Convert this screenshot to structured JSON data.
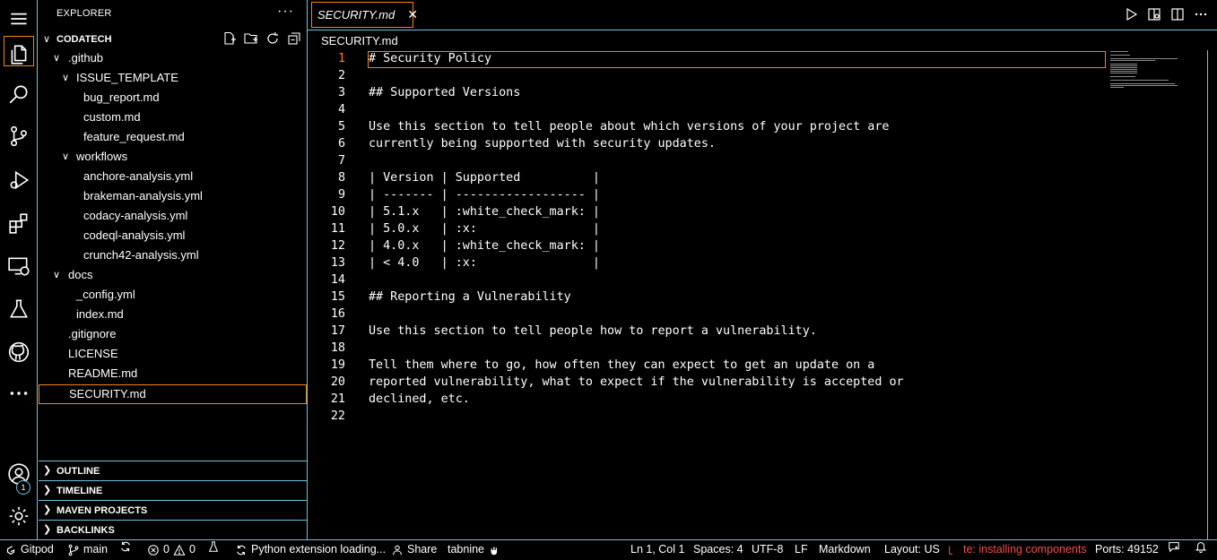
{
  "colors": {
    "accent_border": "#f38518",
    "contrast_border": "#6fc3df",
    "error": "#f14c4c",
    "background": "#000000"
  },
  "activity_bar": {
    "items": [
      "menu-icon",
      "files-icon",
      "search-icon",
      "source-control-icon",
      "run-debug-icon",
      "extensions-icon",
      "remote-explorer-icon",
      "testing-icon",
      "github-icon",
      "more-icon"
    ],
    "accounts_badge": "1"
  },
  "sidebar": {
    "title": "EXPLORER",
    "more": "···",
    "workspace": "CODATECH",
    "tree": [
      {
        "label": ".github",
        "twisty": "∨"
      },
      {
        "label": "ISSUE_TEMPLATE",
        "twisty": "∨"
      },
      {
        "label": "bug_report.md"
      },
      {
        "label": "custom.md"
      },
      {
        "label": "feature_request.md"
      },
      {
        "label": "workflows",
        "twisty": "∨"
      },
      {
        "label": "anchore-analysis.yml"
      },
      {
        "label": "brakeman-analysis.yml"
      },
      {
        "label": "codacy-analysis.yml"
      },
      {
        "label": "codeql-analysis.yml"
      },
      {
        "label": "crunch42-analysis.yml"
      },
      {
        "label": "docs",
        "twisty": "∨"
      },
      {
        "label": "_config.yml"
      },
      {
        "label": "index.md"
      },
      {
        "label": ".gitignore"
      },
      {
        "label": "LICENSE"
      },
      {
        "label": "README.md"
      },
      {
        "label": "SECURITY.md"
      }
    ],
    "panels": [
      "OUTLINE",
      "TIMELINE",
      "MAVEN PROJECTS",
      "BACKLINKS"
    ]
  },
  "editor": {
    "tab_label": "SECURITY.md",
    "tab_close": "✕",
    "breadcrumb": "SECURITY.md",
    "lines": [
      "# Security Policy",
      "",
      "## Supported Versions",
      "",
      "Use this section to tell people about which versions of your project are",
      "currently being supported with security updates.",
      "",
      "| Version | Supported          |",
      "| ------- | ------------------ |",
      "| 5.1.x   | :white_check_mark: |",
      "| 5.0.x   | :x:                |",
      "| 4.0.x   | :white_check_mark: |",
      "| < 4.0   | :x:                |",
      "",
      "## Reporting a Vulnerability",
      "",
      "Use this section to tell people how to report a vulnerability.",
      "",
      "Tell them where to go, how often they can expect to get an update on a",
      "reported vulnerability, what to expect if the vulnerability is accepted or",
      "declined, etc.",
      ""
    ],
    "line_numbers": [
      "1",
      "2",
      "3",
      "4",
      "5",
      "6",
      "7",
      "8",
      "9",
      "10",
      "11",
      "12",
      "13",
      "14",
      "15",
      "16",
      "17",
      "18",
      "19",
      "20",
      "21",
      "22"
    ]
  },
  "status_bar": {
    "gitpod": "Gitpod",
    "branch": "main",
    "errors": "0",
    "warnings": "0",
    "python": "Python extension loading...",
    "share": "Share",
    "tabnine": "tabnine",
    "position": "Ln 1, Col 1",
    "spaces": "Spaces: 4",
    "encoding": "UTF-8",
    "eol": "LF",
    "language": "Markdown",
    "layout": "Layout: US",
    "latex": "te: installing components",
    "ports": "Ports: 49152"
  }
}
